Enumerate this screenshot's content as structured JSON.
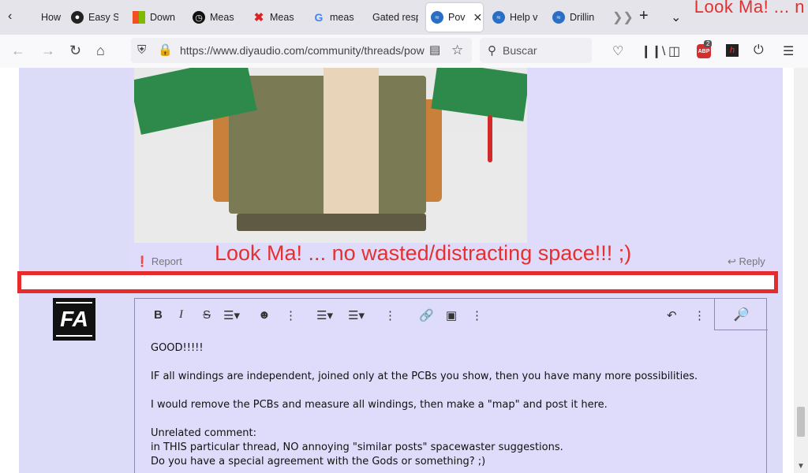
{
  "window": {
    "title_fragment": "Look Ma! ... n"
  },
  "tabs": [
    {
      "label": "How t",
      "icon": "page-icon"
    },
    {
      "label": "Easy S",
      "icon": "circle-icon"
    },
    {
      "label": "Down",
      "icon": "microsoft-icon"
    },
    {
      "label": "Meas",
      "icon": "clock-icon"
    },
    {
      "label": "Meas",
      "icon": "x-icon"
    },
    {
      "label": "meas",
      "icon": "google-icon"
    },
    {
      "label": "Gated resp",
      "icon": "none"
    },
    {
      "label": "Pov",
      "icon": "diyaudio-icon",
      "active": true
    },
    {
      "label": "Help v",
      "icon": "diyaudio-icon"
    },
    {
      "label": "Drillin",
      "icon": "diyaudio-icon"
    }
  ],
  "navbar": {
    "url": "https://www.diyaudio.com/community/threads/pow",
    "search_placeholder": "Buscar",
    "abp_count": "2"
  },
  "post": {
    "report_label": "Report",
    "reply_label": "Reply",
    "annotation": "Look Ma! ... no wasted/distracting space!!!  ;)"
  },
  "avatar": {
    "initials": "FA"
  },
  "editor": {
    "lines": [
      "GOOD!!!!!",
      "",
      "IF all windings are independent, joined only at the PCBs you show, then you have many more possibilities.",
      "",
      "I would remove the PCBs and measure all windings, then make a \"map\" and post it here.",
      "",
      "Unrelated comment:",
      "in THIS particular thread, NO annoying \"similar posts\" spacewaster suggestions.",
      "Do you have a special agreement with the Gods or something? ;)"
    ]
  },
  "colors": {
    "accent": "#e53030",
    "post_bg": "#dcdcf8"
  }
}
